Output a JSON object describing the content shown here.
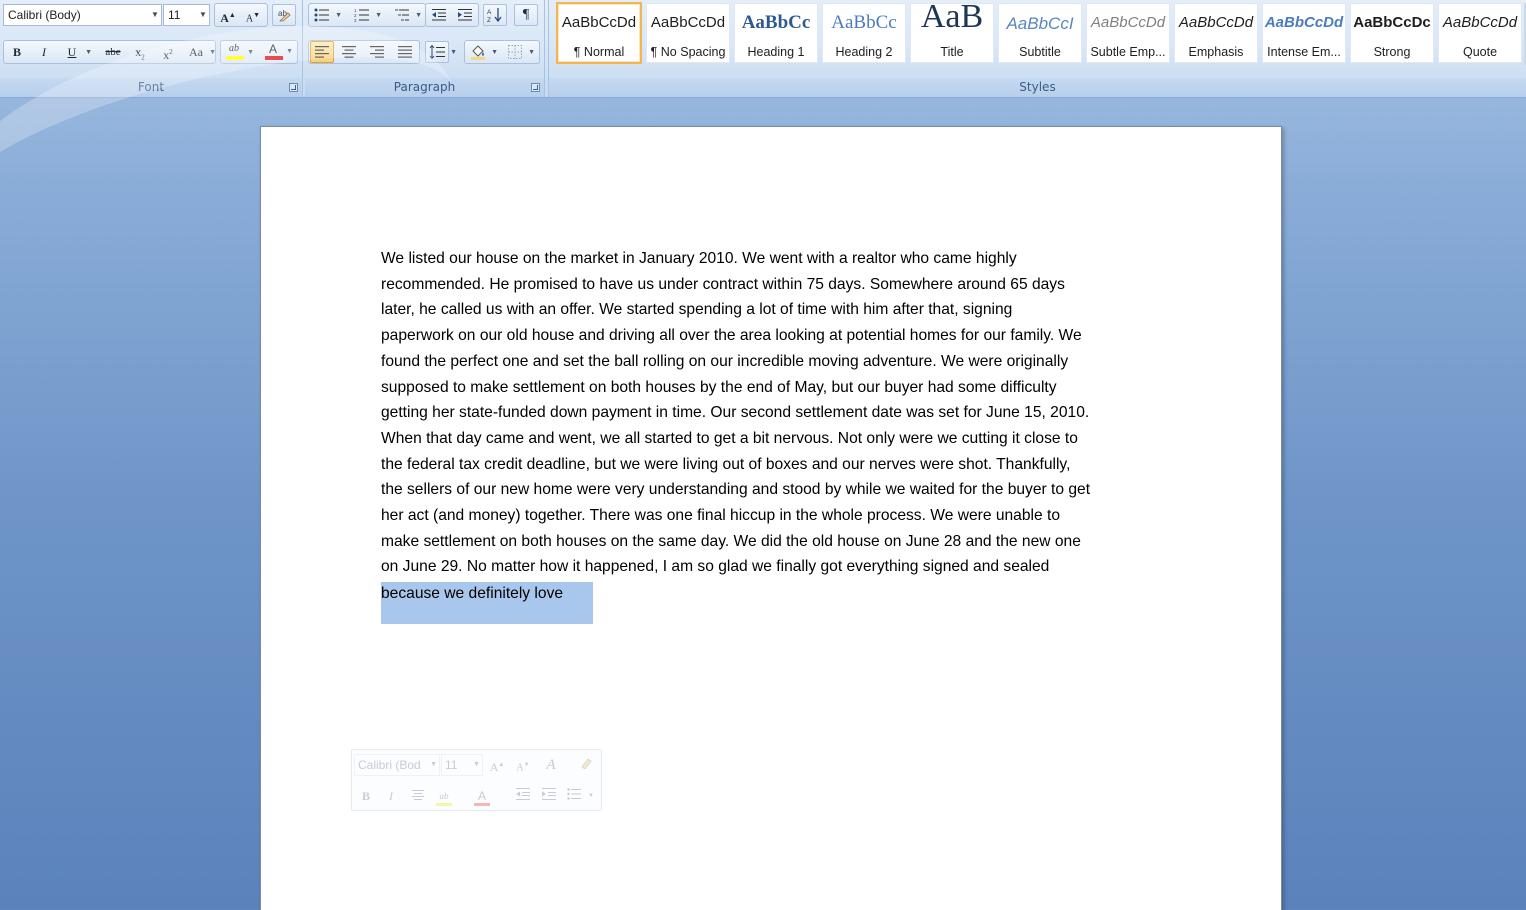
{
  "ribbon": {
    "font_group": {
      "caption": "Font",
      "font_name": "Calibri (Body)",
      "font_size": "11",
      "grow_font": "A",
      "shrink_font": "A",
      "bold": "B",
      "italic": "I",
      "underline": "U",
      "strikethrough": "abe",
      "subscript": "x",
      "superscript": "x",
      "change_case": "Aa",
      "highlight": "ab",
      "font_color": "A",
      "highlight_color": "#ffff00",
      "font_color_value": "#e01010"
    },
    "paragraph_group": {
      "caption": "Paragraph",
      "show_marks": "¶"
    },
    "styles_group": {
      "caption": "Styles",
      "styles": [
        {
          "sample": "AaBbCcDd",
          "label": "¶ Normal"
        },
        {
          "sample": "AaBbCcDd",
          "label": "¶ No Spacing"
        },
        {
          "sample": "AaBbCc",
          "label": "Heading 1"
        },
        {
          "sample": "AaBbCc",
          "label": "Heading 2"
        },
        {
          "sample": "AaB",
          "label": "Title"
        },
        {
          "sample": "AaBbCcI",
          "label": "Subtitle"
        },
        {
          "sample": "AaBbCcDd",
          "label": "Subtle Emp..."
        },
        {
          "sample": "AaBbCcDd",
          "label": "Emphasis"
        },
        {
          "sample": "AaBbCcDd",
          "label": "Intense Em..."
        },
        {
          "sample": "AaBbCcDc",
          "label": "Strong"
        },
        {
          "sample": "AaBbCcDd",
          "label": "Quote"
        }
      ]
    }
  },
  "document": {
    "lines": [
      "We listed our house on the market in January 2010.  We went with a realtor who came highly",
      "recommended.  He promised to have us under contract within 75 days.  Somewhere around 65 days",
      "later, he called us with an offer.  We started spending  a lot of time with him after that, signing",
      "paperwork on our old house and driving all over the area looking at potential homes for our family.  We",
      "found the perfect one and set the ball rolling on our incredible  moving adventure.   We were originally",
      "supposed to make settlement on both houses by the end of May, but our buyer had some difficulty",
      "getting her state-funded down payment  in time.  Our second settlement  date was set for June 15, 2010.",
      "When that day came and went, we all started to get a bit nervous.  Not only were we cutting it close to",
      "the federal tax credit deadline, but we were living out of boxes and our nerves were shot.  Thankfully,",
      "the sellers of our new home were very understanding  and stood by while we waited for the buyer to get",
      "her act (and money) together.  There was one final hiccup in the whole process.  We were unable to",
      "make settlement  on both houses on the same day.  We did the old house on June 28 and the new one",
      "on June 29.  No matter how it happened,  I am so glad we finally got everything  signed and sealed"
    ],
    "selected_text": "because we definitely love"
  },
  "mini_toolbar": {
    "font_name": "Calibri (Bod",
    "font_size": "11"
  }
}
